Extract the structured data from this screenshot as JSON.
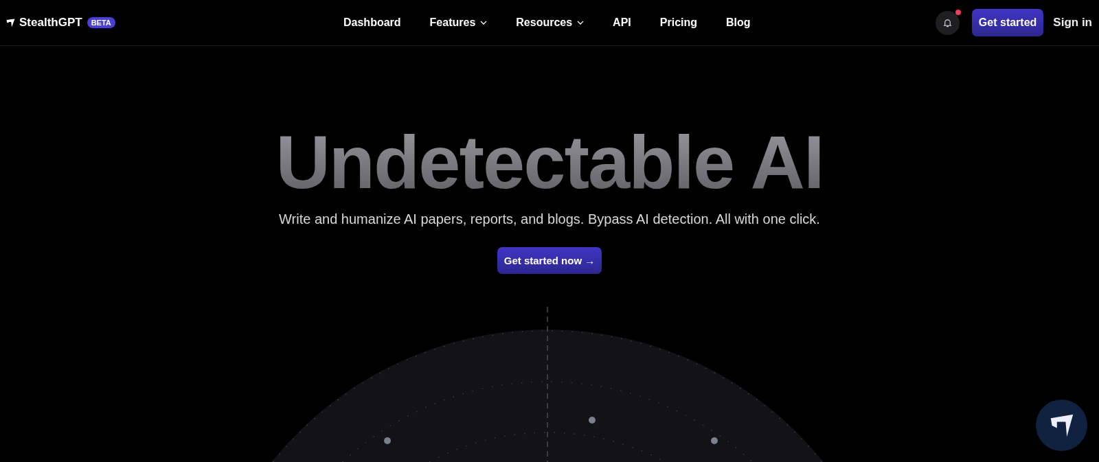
{
  "header": {
    "brand": "StealthGPT",
    "badge": "BETA",
    "nav": [
      {
        "label": "Dashboard",
        "kind": "link"
      },
      {
        "label": "Features",
        "kind": "menu"
      },
      {
        "label": "Resources",
        "kind": "menu"
      },
      {
        "label": "API",
        "kind": "link"
      },
      {
        "label": "Pricing",
        "kind": "link"
      },
      {
        "label": "Blog",
        "kind": "link"
      }
    ],
    "notification_unread": true,
    "cta": "Get started",
    "sign_in": "Sign in"
  },
  "hero": {
    "title": "Undetectable AI",
    "subtitle": "Write and humanize AI papers, reports, and blogs. Bypass AI detection. All with one click.",
    "button": "Get started now →"
  }
}
